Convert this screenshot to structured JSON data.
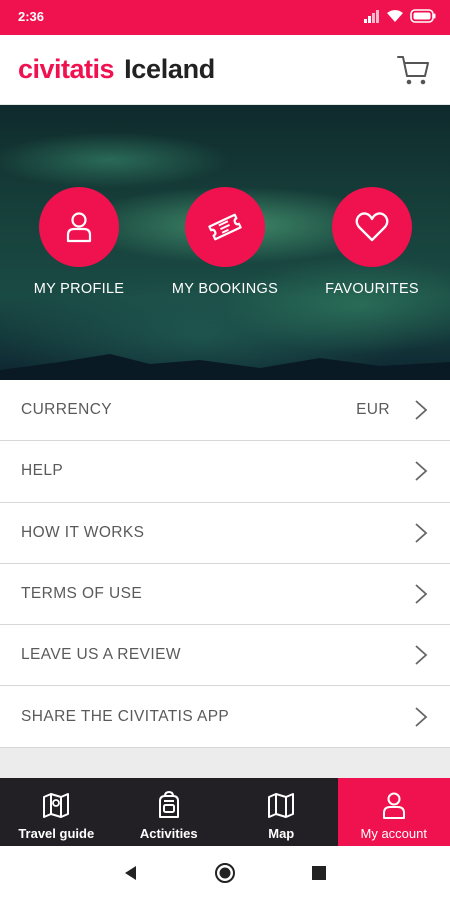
{
  "status_bar": {
    "time": "2:36"
  },
  "header": {
    "brand": "civitatis",
    "title": "Iceland",
    "cart_icon": "shopping-cart-icon"
  },
  "shortcuts": [
    {
      "label": "MY PROFILE",
      "icon": "user-icon"
    },
    {
      "label": "MY BOOKINGS",
      "icon": "ticket-icon"
    },
    {
      "label": "FAVOURITES",
      "icon": "heart-icon"
    }
  ],
  "menu": {
    "items": [
      {
        "label": "CURRENCY",
        "value": "EUR"
      },
      {
        "label": "HELP"
      },
      {
        "label": "HOW IT WORKS"
      },
      {
        "label": "TERMS OF USE"
      },
      {
        "label": "LEAVE US A REVIEW"
      },
      {
        "label": "SHARE THE CIVITATIS APP"
      }
    ]
  },
  "bottom_nav": {
    "items": [
      {
        "label": "Travel guide",
        "icon": "map-book-icon"
      },
      {
        "label": "Activities",
        "icon": "backpack-icon"
      },
      {
        "label": "Map",
        "icon": "map-icon"
      },
      {
        "label": "My account",
        "icon": "user-icon",
        "active": true
      }
    ]
  },
  "colors": {
    "accent": "#f0114f",
    "nav_bg": "#222024",
    "text": "#5a5a5a"
  }
}
